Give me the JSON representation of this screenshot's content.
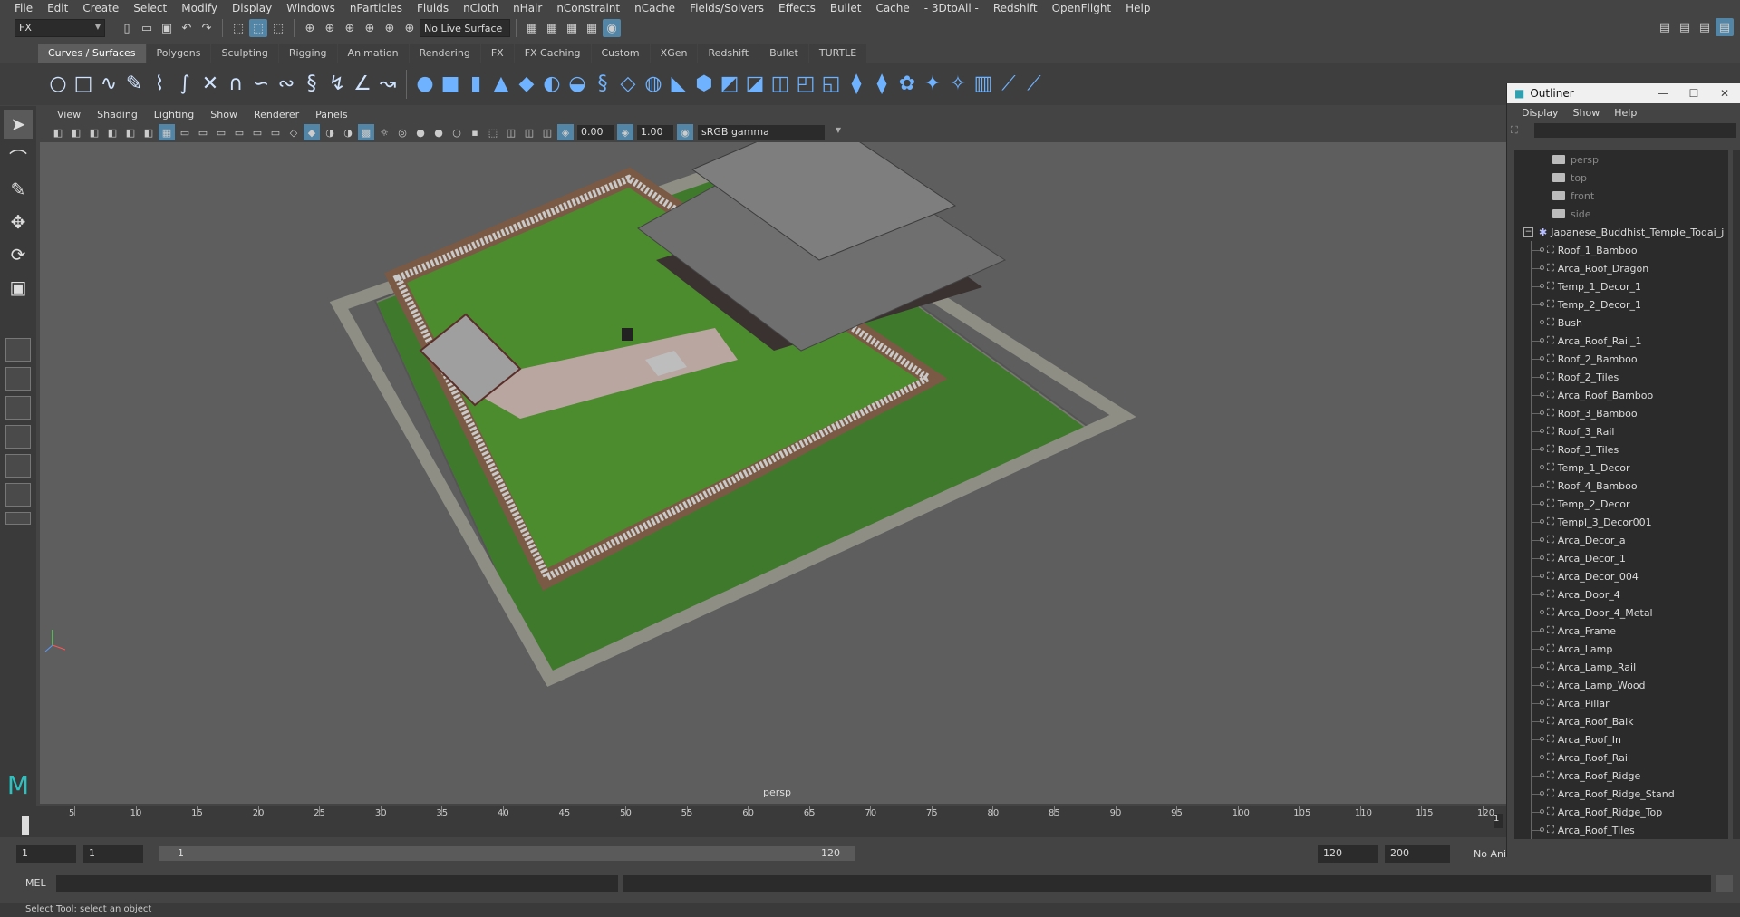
{
  "menubar": {
    "items": [
      "File",
      "Edit",
      "Create",
      "Select",
      "Modify",
      "Display",
      "Windows",
      "nParticles",
      "Fluids",
      "nCloth",
      "nHair",
      "nConstraint",
      "nCache",
      "Fields/Solvers",
      "Effects",
      "Bullet",
      "Cache",
      "- 3DtoAll -",
      "Redshift",
      "OpenFlight",
      "Help"
    ]
  },
  "statusline": {
    "mode": "FX",
    "live_surface": "No Live Surface"
  },
  "shelf": {
    "tabs": [
      "Curves / Surfaces",
      "Polygons",
      "Sculpting",
      "Rigging",
      "Animation",
      "Rendering",
      "FX",
      "FX Caching",
      "Custom",
      "XGen",
      "Redshift",
      "Bullet",
      "TURTLE"
    ],
    "active_tab": "Curves / Surfaces"
  },
  "viewport": {
    "menu": [
      "View",
      "Shading",
      "Lighting",
      "Show",
      "Renderer",
      "Panels"
    ],
    "exposure": "0.00",
    "gamma": "1.00",
    "color_space": "sRGB gamma",
    "camera_label": "persp"
  },
  "timeline": {
    "ticks": [
      "5",
      "10",
      "15",
      "20",
      "25",
      "30",
      "35",
      "40",
      "45",
      "50",
      "55",
      "60",
      "65",
      "70",
      "75",
      "80",
      "85",
      "90",
      "95",
      "100",
      "105",
      "110",
      "115",
      "120"
    ],
    "current": "1",
    "range_start": "1",
    "range_start2": "1",
    "range_slider_start": "1",
    "range_slider_end": "120",
    "range_end": "120",
    "range_end2": "200",
    "anim_layer": "No Ani"
  },
  "cmdline": {
    "label": "MEL"
  },
  "helpline": {
    "text": "Select Tool: select an object"
  },
  "outliner": {
    "title": "Outliner",
    "menu": [
      "Display",
      "Show",
      "Help"
    ],
    "cameras": [
      "persp",
      "top",
      "front",
      "side"
    ],
    "root": "Japanese_Buddhist_Temple_Todai_j",
    "children": [
      "Roof_1_Bamboo",
      "Arca_Roof_Dragon",
      "Temp_1_Decor_1",
      "Temp_2_Decor_1",
      "Bush",
      "Arca_Roof_Rail_1",
      "Roof_2_Bamboo",
      "Roof_2_Tiles",
      "Arca_Roof_Bamboo",
      "Roof_3_Bamboo",
      "Roof_3_Rail",
      "Roof_3_Tiles",
      "Temp_1_Decor",
      "Roof_4_Bamboo",
      "Temp_2_Decor",
      "Templ_3_Decor001",
      "Arca_Decor_a",
      "Arca_Decor_1",
      "Arca_Decor_004",
      "Arca_Door_4",
      "Arca_Door_4_Metal",
      "Arca_Frame",
      "Arca_Lamp",
      "Arca_Lamp_Rail",
      "Arca_Lamp_Wood",
      "Arca_Pillar",
      "Arca_Roof_Balk",
      "Arca_Roof_In",
      "Arca_Roof_Rail",
      "Arca_Roof_Ridge",
      "Arca_Roof_Ridge_Stand",
      "Arca_Roof_Ridge_Top",
      "Arca_Roof_Tiles"
    ]
  }
}
